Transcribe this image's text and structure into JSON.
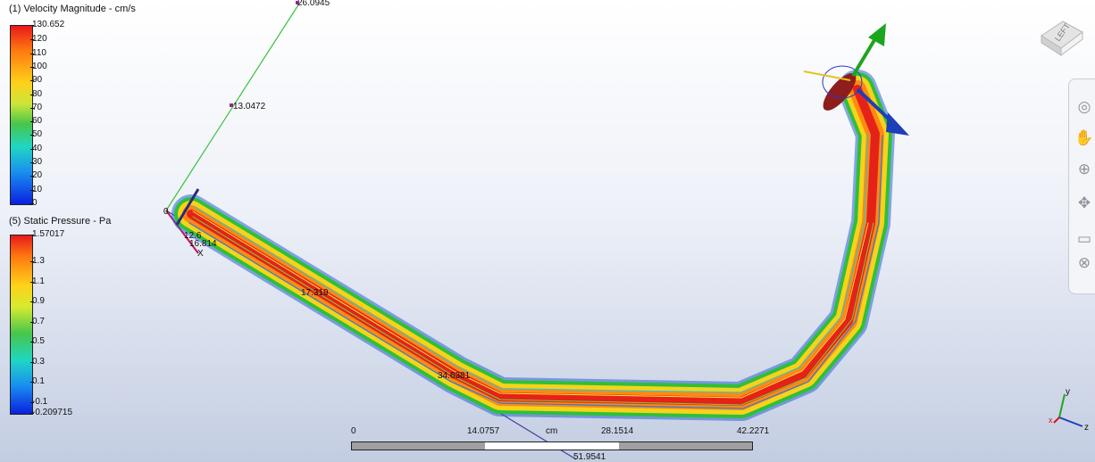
{
  "legend_velocity": {
    "title": "(1) Velocity Magnitude - cm/s",
    "max": "130.652",
    "ticks": [
      "120",
      "110",
      "100",
      "90",
      "80",
      "70",
      "60",
      "50",
      "40",
      "30",
      "20",
      "10",
      "0"
    ],
    "colors": [
      "#e8191b",
      "#ff7a10",
      "#ffd11a",
      "#47c64b",
      "#1fd6c3",
      "#1a8ff0",
      "#0a21e0"
    ]
  },
  "legend_pressure": {
    "title": "(5) Static Pressure - Pa",
    "max": "1.57017",
    "ticks": [
      "1.3",
      "1.1",
      "0.9",
      "0.7",
      "0.5",
      "0.3",
      "0.1",
      "-0.1"
    ],
    "min": "-0.209715"
  },
  "probe_labels": {
    "p1": "26.0945",
    "p2": "13.0472",
    "p3": "0",
    "p4": "17.319",
    "p5": "34.6381",
    "p6": "51.9541",
    "p7": "12.6",
    "p8": "16.814",
    "p9": "X"
  },
  "scale": {
    "labels": [
      "0",
      "14.0757",
      "cm",
      "28.1514",
      "42.2271"
    ]
  },
  "viewcube": {
    "face": "LEFT"
  },
  "triad": {
    "y": "y",
    "x": "x",
    "z": "z"
  },
  "nav_icons": [
    "orbit-icon",
    "look-icon",
    "pan-icon",
    "zoom-icon",
    "fit-icon",
    "walk-icon",
    "rewind-icon"
  ]
}
